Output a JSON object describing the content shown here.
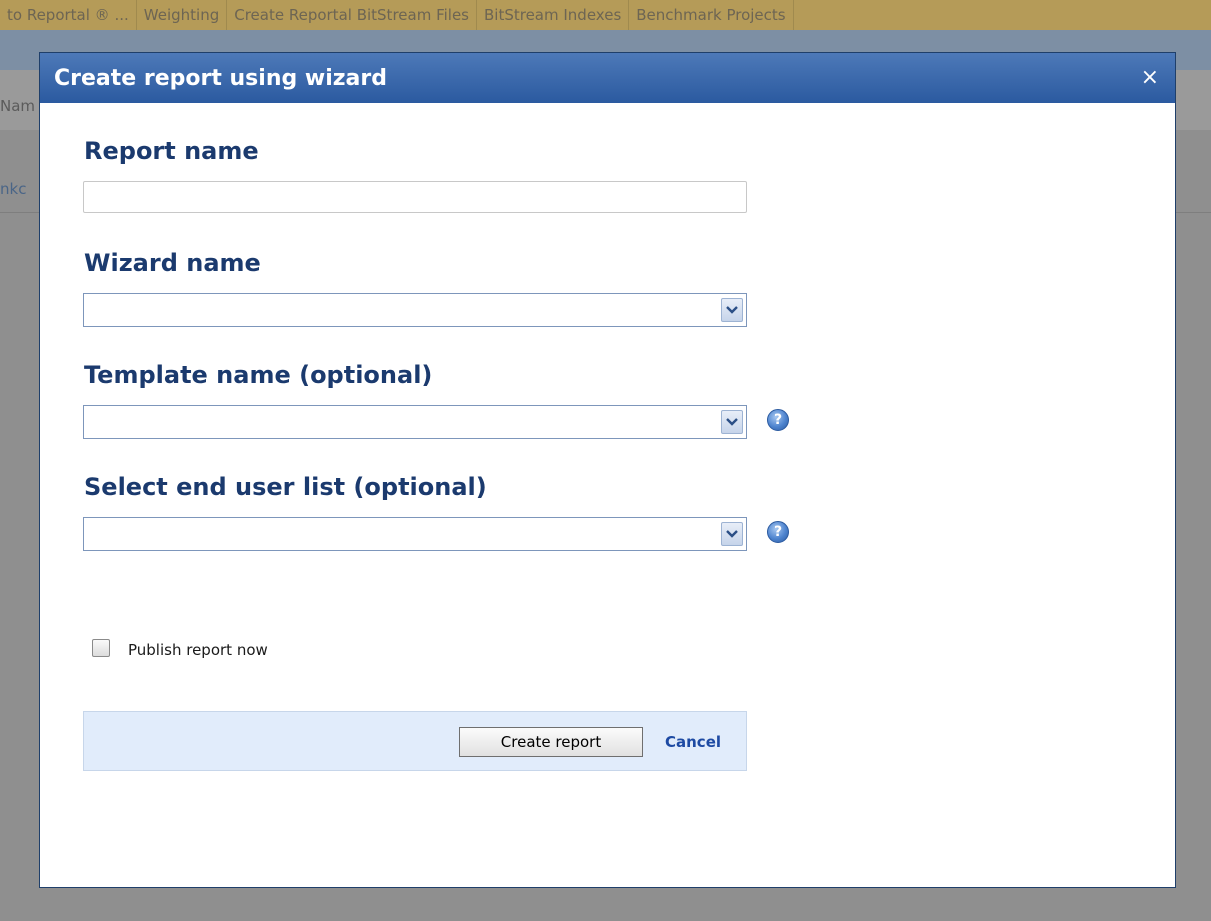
{
  "background": {
    "tabs": [
      "to Reportal ® ...",
      "Weighting",
      "Create Reportal BitStream Files",
      "BitStream Indexes",
      "Benchmark Projects"
    ],
    "column_label": "Nam",
    "link_text": "nkc"
  },
  "dialog": {
    "title": "Create report using wizard",
    "close_glyph": "×",
    "report_name": {
      "label": "Report name",
      "value": ""
    },
    "wizard_name": {
      "label": "Wizard name",
      "value": ""
    },
    "template_name": {
      "label": "Template name (optional)",
      "value": "",
      "help": "?"
    },
    "end_user_list": {
      "label": "Select end user list (optional)",
      "value": "",
      "help": "?"
    },
    "publish": {
      "label": "Publish report now",
      "checked": false
    },
    "actions": {
      "create_label": "Create report",
      "cancel_label": "Cancel"
    }
  },
  "colors": {
    "header_top": "#4d79b8",
    "header_bottom": "#2b5aa0",
    "label_text": "#1b3a6e",
    "action_bar_bg": "#e1ecfb",
    "cancel_link": "#1d4aa3",
    "overlay": "#8f8f8f"
  }
}
